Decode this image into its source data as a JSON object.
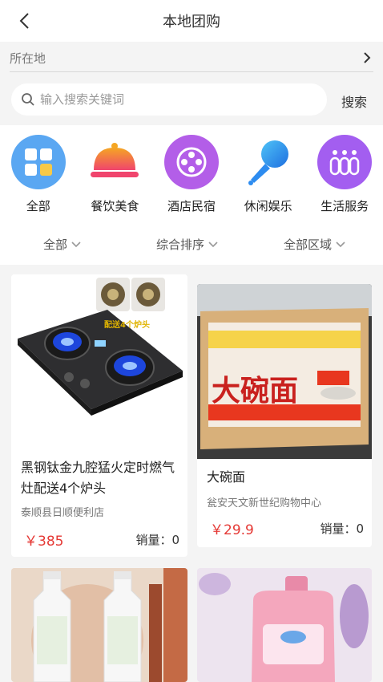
{
  "header": {
    "title": "本地团购",
    "back_icon": "chevron-left-icon"
  },
  "location": {
    "placeholder": "所在地",
    "arrow_icon": "chevron-right-icon"
  },
  "search": {
    "placeholder": "输入搜索关键词",
    "button_label": "搜索",
    "icon": "search-icon"
  },
  "categories": [
    {
      "label": "全部",
      "icon": "grid-icon",
      "color": "#5aa7f2"
    },
    {
      "label": "餐饮美食",
      "icon": "food-cloche-icon",
      "color": "#f25d6a"
    },
    {
      "label": "酒店民宿",
      "icon": "film-reel-icon",
      "color": "#b35ee8"
    },
    {
      "label": "休闲娱乐",
      "icon": "pipette-icon",
      "color": "#2d8cf0"
    },
    {
      "label": "生活服务",
      "icon": "bottles-icon",
      "color": "#a35ef0"
    }
  ],
  "filters": [
    {
      "label": "全部"
    },
    {
      "label": "综合排序"
    },
    {
      "label": "全部区域"
    }
  ],
  "products": [
    {
      "name": "黑钢钛金九腔猛火定时燃气灶配送4个炉头",
      "shop": "泰顺县日顺便利店",
      "price": "￥385",
      "sales": "销量：0",
      "image_caption": "配送4个炉头"
    },
    {
      "name": "大碗面",
      "shop": "瓮安天文新世纪购物中心",
      "price": "￥29.9",
      "sales": "销量：0",
      "image_caption": "大碗面"
    },
    {
      "name": "",
      "shop": "",
      "price": "",
      "sales": ""
    },
    {
      "name": "",
      "shop": "",
      "price": "",
      "sales": ""
    }
  ],
  "colors": {
    "accent": "#e53935",
    "background": "#f4f4f4"
  }
}
